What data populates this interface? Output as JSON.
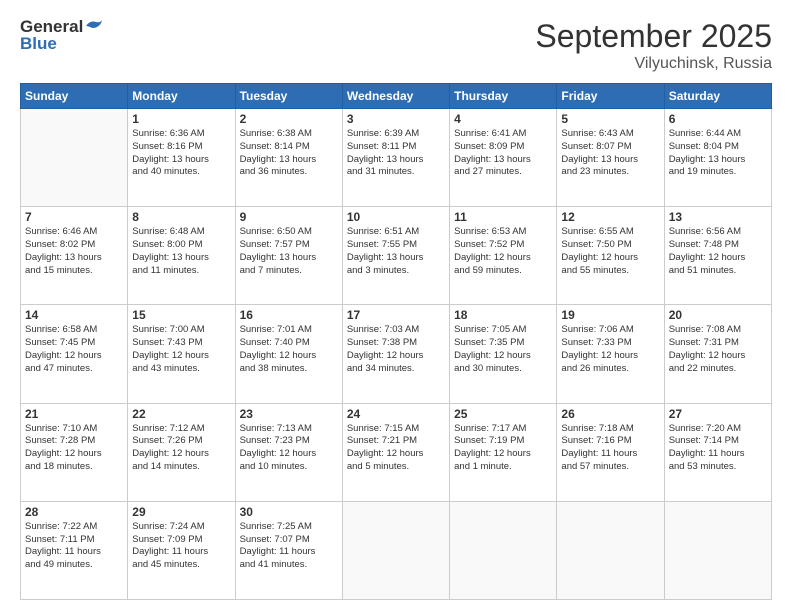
{
  "header": {
    "logo_general": "General",
    "logo_blue": "Blue",
    "month": "September 2025",
    "location": "Vilyuchinsk, Russia"
  },
  "weekdays": [
    "Sunday",
    "Monday",
    "Tuesday",
    "Wednesday",
    "Thursday",
    "Friday",
    "Saturday"
  ],
  "weeks": [
    [
      {
        "day": "",
        "lines": []
      },
      {
        "day": "1",
        "lines": [
          "Sunrise: 6:36 AM",
          "Sunset: 8:16 PM",
          "Daylight: 13 hours",
          "and 40 minutes."
        ]
      },
      {
        "day": "2",
        "lines": [
          "Sunrise: 6:38 AM",
          "Sunset: 8:14 PM",
          "Daylight: 13 hours",
          "and 36 minutes."
        ]
      },
      {
        "day": "3",
        "lines": [
          "Sunrise: 6:39 AM",
          "Sunset: 8:11 PM",
          "Daylight: 13 hours",
          "and 31 minutes."
        ]
      },
      {
        "day": "4",
        "lines": [
          "Sunrise: 6:41 AM",
          "Sunset: 8:09 PM",
          "Daylight: 13 hours",
          "and 27 minutes."
        ]
      },
      {
        "day": "5",
        "lines": [
          "Sunrise: 6:43 AM",
          "Sunset: 8:07 PM",
          "Daylight: 13 hours",
          "and 23 minutes."
        ]
      },
      {
        "day": "6",
        "lines": [
          "Sunrise: 6:44 AM",
          "Sunset: 8:04 PM",
          "Daylight: 13 hours",
          "and 19 minutes."
        ]
      }
    ],
    [
      {
        "day": "7",
        "lines": [
          "Sunrise: 6:46 AM",
          "Sunset: 8:02 PM",
          "Daylight: 13 hours",
          "and 15 minutes."
        ]
      },
      {
        "day": "8",
        "lines": [
          "Sunrise: 6:48 AM",
          "Sunset: 8:00 PM",
          "Daylight: 13 hours",
          "and 11 minutes."
        ]
      },
      {
        "day": "9",
        "lines": [
          "Sunrise: 6:50 AM",
          "Sunset: 7:57 PM",
          "Daylight: 13 hours",
          "and 7 minutes."
        ]
      },
      {
        "day": "10",
        "lines": [
          "Sunrise: 6:51 AM",
          "Sunset: 7:55 PM",
          "Daylight: 13 hours",
          "and 3 minutes."
        ]
      },
      {
        "day": "11",
        "lines": [
          "Sunrise: 6:53 AM",
          "Sunset: 7:52 PM",
          "Daylight: 12 hours",
          "and 59 minutes."
        ]
      },
      {
        "day": "12",
        "lines": [
          "Sunrise: 6:55 AM",
          "Sunset: 7:50 PM",
          "Daylight: 12 hours",
          "and 55 minutes."
        ]
      },
      {
        "day": "13",
        "lines": [
          "Sunrise: 6:56 AM",
          "Sunset: 7:48 PM",
          "Daylight: 12 hours",
          "and 51 minutes."
        ]
      }
    ],
    [
      {
        "day": "14",
        "lines": [
          "Sunrise: 6:58 AM",
          "Sunset: 7:45 PM",
          "Daylight: 12 hours",
          "and 47 minutes."
        ]
      },
      {
        "day": "15",
        "lines": [
          "Sunrise: 7:00 AM",
          "Sunset: 7:43 PM",
          "Daylight: 12 hours",
          "and 43 minutes."
        ]
      },
      {
        "day": "16",
        "lines": [
          "Sunrise: 7:01 AM",
          "Sunset: 7:40 PM",
          "Daylight: 12 hours",
          "and 38 minutes."
        ]
      },
      {
        "day": "17",
        "lines": [
          "Sunrise: 7:03 AM",
          "Sunset: 7:38 PM",
          "Daylight: 12 hours",
          "and 34 minutes."
        ]
      },
      {
        "day": "18",
        "lines": [
          "Sunrise: 7:05 AM",
          "Sunset: 7:35 PM",
          "Daylight: 12 hours",
          "and 30 minutes."
        ]
      },
      {
        "day": "19",
        "lines": [
          "Sunrise: 7:06 AM",
          "Sunset: 7:33 PM",
          "Daylight: 12 hours",
          "and 26 minutes."
        ]
      },
      {
        "day": "20",
        "lines": [
          "Sunrise: 7:08 AM",
          "Sunset: 7:31 PM",
          "Daylight: 12 hours",
          "and 22 minutes."
        ]
      }
    ],
    [
      {
        "day": "21",
        "lines": [
          "Sunrise: 7:10 AM",
          "Sunset: 7:28 PM",
          "Daylight: 12 hours",
          "and 18 minutes."
        ]
      },
      {
        "day": "22",
        "lines": [
          "Sunrise: 7:12 AM",
          "Sunset: 7:26 PM",
          "Daylight: 12 hours",
          "and 14 minutes."
        ]
      },
      {
        "day": "23",
        "lines": [
          "Sunrise: 7:13 AM",
          "Sunset: 7:23 PM",
          "Daylight: 12 hours",
          "and 10 minutes."
        ]
      },
      {
        "day": "24",
        "lines": [
          "Sunrise: 7:15 AM",
          "Sunset: 7:21 PM",
          "Daylight: 12 hours",
          "and 5 minutes."
        ]
      },
      {
        "day": "25",
        "lines": [
          "Sunrise: 7:17 AM",
          "Sunset: 7:19 PM",
          "Daylight: 12 hours",
          "and 1 minute."
        ]
      },
      {
        "day": "26",
        "lines": [
          "Sunrise: 7:18 AM",
          "Sunset: 7:16 PM",
          "Daylight: 11 hours",
          "and 57 minutes."
        ]
      },
      {
        "day": "27",
        "lines": [
          "Sunrise: 7:20 AM",
          "Sunset: 7:14 PM",
          "Daylight: 11 hours",
          "and 53 minutes."
        ]
      }
    ],
    [
      {
        "day": "28",
        "lines": [
          "Sunrise: 7:22 AM",
          "Sunset: 7:11 PM",
          "Daylight: 11 hours",
          "and 49 minutes."
        ]
      },
      {
        "day": "29",
        "lines": [
          "Sunrise: 7:24 AM",
          "Sunset: 7:09 PM",
          "Daylight: 11 hours",
          "and 45 minutes."
        ]
      },
      {
        "day": "30",
        "lines": [
          "Sunrise: 7:25 AM",
          "Sunset: 7:07 PM",
          "Daylight: 11 hours",
          "and 41 minutes."
        ]
      },
      {
        "day": "",
        "lines": []
      },
      {
        "day": "",
        "lines": []
      },
      {
        "day": "",
        "lines": []
      },
      {
        "day": "",
        "lines": []
      }
    ]
  ]
}
